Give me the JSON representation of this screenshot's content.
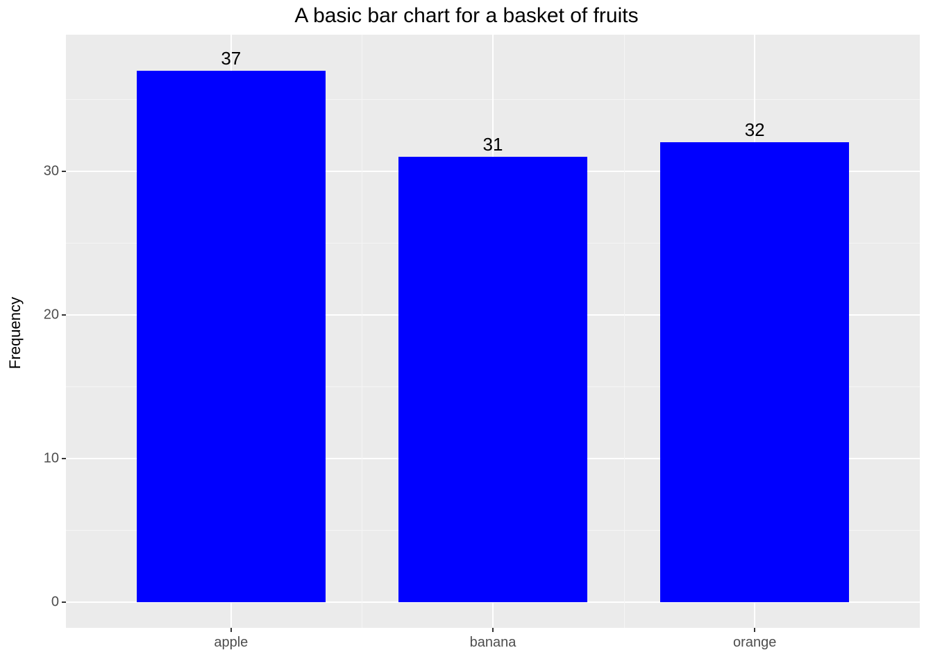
{
  "chart_data": {
    "type": "bar",
    "title": "A basic bar chart for a basket of fruits",
    "xlabel": "",
    "ylabel": "Frequency",
    "categories": [
      "apple",
      "banana",
      "orange"
    ],
    "values": [
      37,
      31,
      32
    ],
    "ylim": [
      0,
      40
    ],
    "yticks": [
      0,
      10,
      20,
      30
    ],
    "bar_color": "#0000ff",
    "panel_bg": "#ebebeb"
  }
}
